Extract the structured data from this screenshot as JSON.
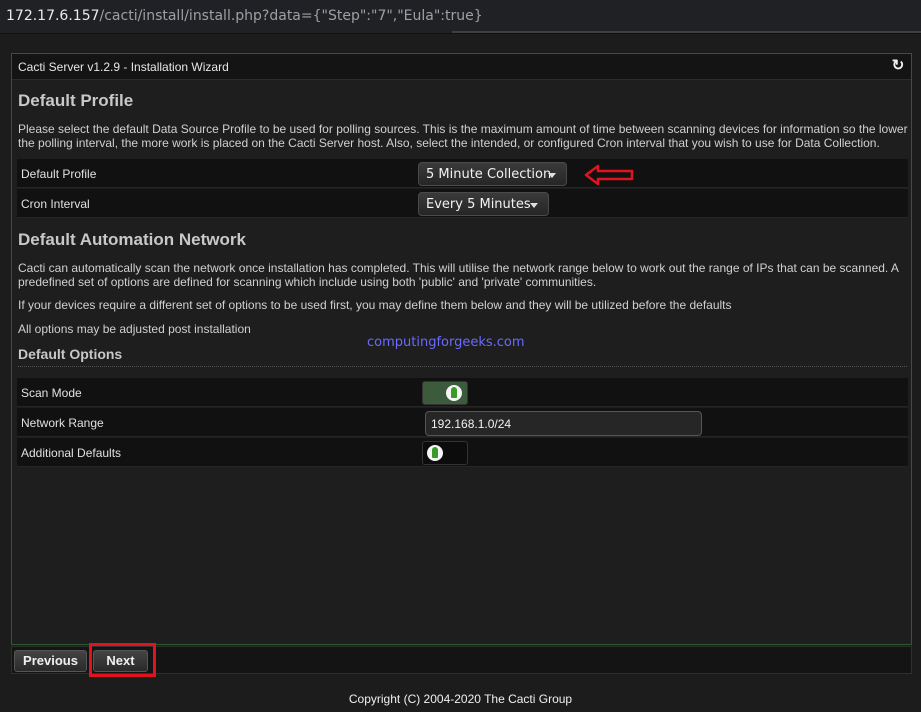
{
  "browser": {
    "url_host": "172.17.6.157",
    "url_path": "/cacti/install/install.php?data={\"Step\":\"7\",\"Eula\":true}"
  },
  "wizard": {
    "title": "Cacti Server v1.2.9 - Installation Wizard",
    "refresh_icon": "refresh-icon"
  },
  "default_profile": {
    "heading": "Default Profile",
    "description": "Please select the default Data Source Profile to be used for polling sources. This is the maximum amount of time between scanning devices for information so the lower the polling interval, the more work is placed on the Cacti Server host. Also, select the intended, or configured Cron interval that you wish to use for Data Collection.",
    "profile_label": "Default Profile",
    "profile_value": "5 Minute Collection",
    "cron_label": "Cron Interval",
    "cron_value": "Every 5 Minutes"
  },
  "automation": {
    "heading": "Default Automation Network",
    "description": "Cacti can automatically scan the network once installation has completed. This will utilise the network range below to work out the range of IPs that can be scanned. A predefined set of options are defined for scanning which include using both 'public' and 'private' communities.",
    "note1": "If your devices require a different set of options to be used first, you may define them below and they will be utilized before the defaults",
    "note2": "All options may be adjusted post installation"
  },
  "default_options": {
    "heading": "Default Options",
    "scan_mode_label": "Scan Mode",
    "scan_mode_on": true,
    "network_range_label": "Network Range",
    "network_range_value": "192.168.1.0/24",
    "additional_defaults_label": "Additional Defaults",
    "additional_defaults_on": false
  },
  "watermark": "computingforgeeks.com",
  "nav": {
    "previous_label": "Previous",
    "next_label": "Next"
  },
  "footer": "Copyright (C) 2004-2020 The Cacti Group",
  "colors": {
    "annotation_red": "#e0141e",
    "toggle_on": "#3c5a3c",
    "panel_border": "#2f5a2f"
  }
}
